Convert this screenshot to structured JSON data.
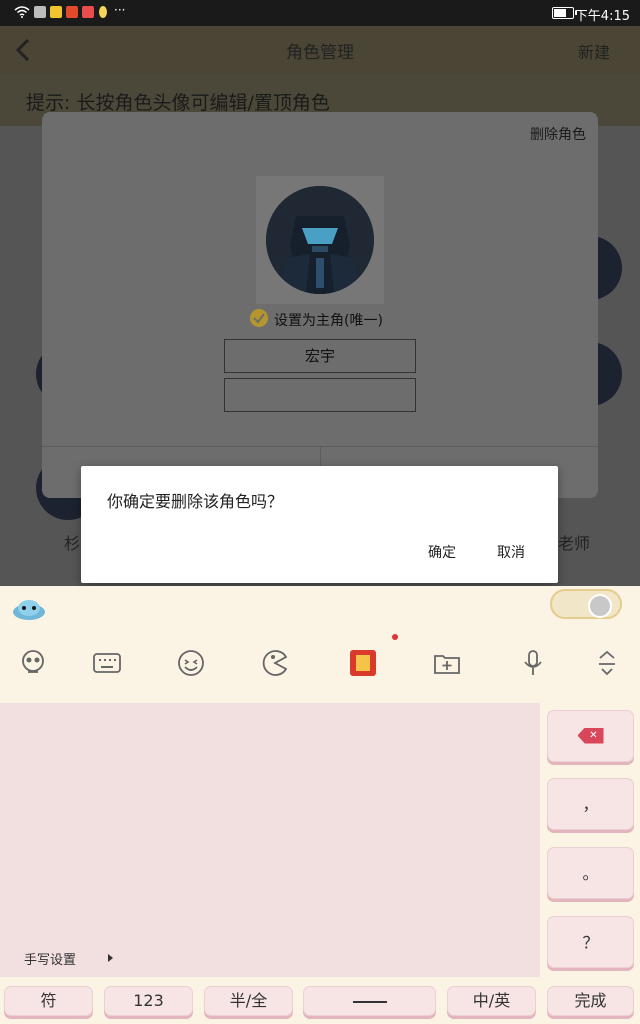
{
  "status_bar": {
    "time": "下午4:15",
    "dots": "···",
    "battery_level": 0.65
  },
  "app_bar": {
    "title": "角色管理",
    "new_label": "新建"
  },
  "hint": "提示: 长按角色头像可编辑/置顶角色",
  "background_labels": {
    "left": "杉",
    "right": "老师"
  },
  "role_card": {
    "delete_label": "删除角色",
    "main_role_label": "设置为主角(唯一)",
    "name_value": "宏宇",
    "second_value": ""
  },
  "dialog": {
    "message": "你确定要删除该角色吗？",
    "confirm": "确定",
    "cancel": "取消"
  },
  "keyboard": {
    "handwriting_settings": "手写设置",
    "side_keys": {
      "comma": "，",
      "period": "。",
      "question": "？"
    },
    "bottom_keys": {
      "symbols": "符",
      "numbers": "123",
      "half_full": "半/全",
      "zh_en": "中/英",
      "done": "完成"
    }
  },
  "colors": {
    "accent_gold": "#b5962e",
    "delete_red": "#d9475a",
    "key_pink": "#f7e4e4"
  }
}
